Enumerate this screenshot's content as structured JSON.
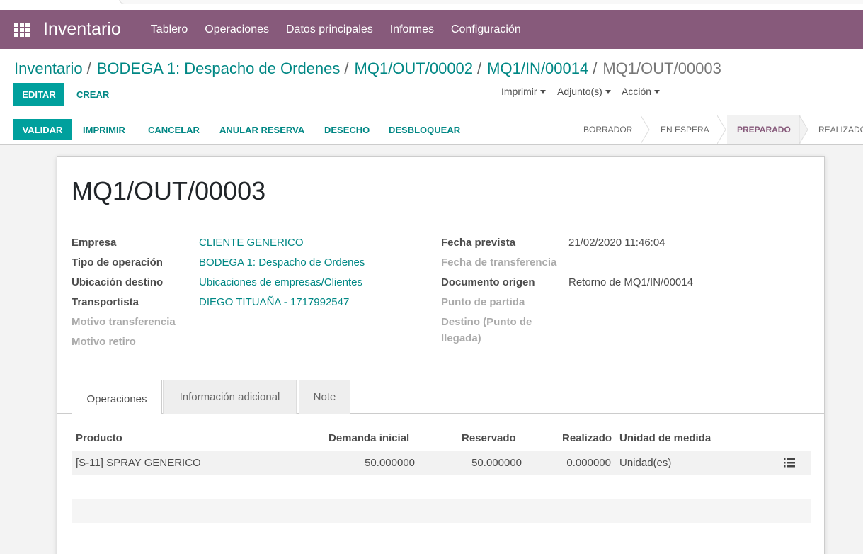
{
  "navbar": {
    "brand": "Inventario",
    "menu": [
      "Tablero",
      "Operaciones",
      "Datos principales",
      "Informes",
      "Configuración"
    ]
  },
  "breadcrumb": {
    "items": [
      "Inventario",
      "BODEGA 1: Despacho de Ordenes",
      "MQ1/OUT/00002",
      "MQ1/IN/00014"
    ],
    "current": "MQ1/OUT/00003",
    "separator": "/"
  },
  "buttons": {
    "edit": "EDITAR",
    "create": "CREAR",
    "print_dd": "Imprimir",
    "attach_dd": "Adjunto(s)",
    "action_dd": "Acción"
  },
  "statusbar": {
    "validate": "VALIDAR",
    "print": "IMPRIMIR",
    "cancel": "CANCELAR",
    "unreserve": "ANULAR RESERVA",
    "scrap": "DESECHO",
    "unlock": "DESBLOQUEAR",
    "stages": [
      "BORRADOR",
      "EN ESPERA",
      "PREPARADO",
      "REALIZADO"
    ],
    "active_stage": "PREPARADO"
  },
  "form": {
    "title": "MQ1/OUT/00003",
    "left": {
      "empresa_label": "Empresa",
      "empresa_value": "CLIENTE GENERICO",
      "tipo_label": "Tipo de operación",
      "tipo_value": "BODEGA 1: Despacho de Ordenes",
      "ubicacion_label": "Ubicación destino",
      "ubicacion_value": "Ubicaciones de empresas/Clientes",
      "transportista_label": "Transportista",
      "transportista_value": "DIEGO TITUAÑA - 1717992547",
      "motivo_transf_label": "Motivo transferencia",
      "motivo_retiro_label": "Motivo retiro"
    },
    "right": {
      "fecha_prevista_label": "Fecha prevista",
      "fecha_prevista_value": "21/02/2020 11:46:04",
      "fecha_transf_label": "Fecha de transferencia",
      "doc_origen_label": "Documento origen",
      "doc_origen_value": "Retorno de MQ1/IN/00014",
      "punto_partida_label": "Punto de partida",
      "destino_label_1": "Destino (Punto de",
      "destino_label_2": "llegada)"
    }
  },
  "tabs": [
    "Operaciones",
    "Información adicional",
    "Note"
  ],
  "table": {
    "headers": [
      "Producto",
      "Demanda inicial",
      "Reservado",
      "Realizado",
      "Unidad de medida"
    ],
    "rows": [
      [
        "[S-11] SPRAY GENERICO",
        "50.000000",
        "50.000000",
        "0.000000",
        "Unidad(es)"
      ]
    ]
  },
  "colors": {
    "navbar": "#875a7b",
    "primary": "#00a09d",
    "link": "#008784"
  }
}
